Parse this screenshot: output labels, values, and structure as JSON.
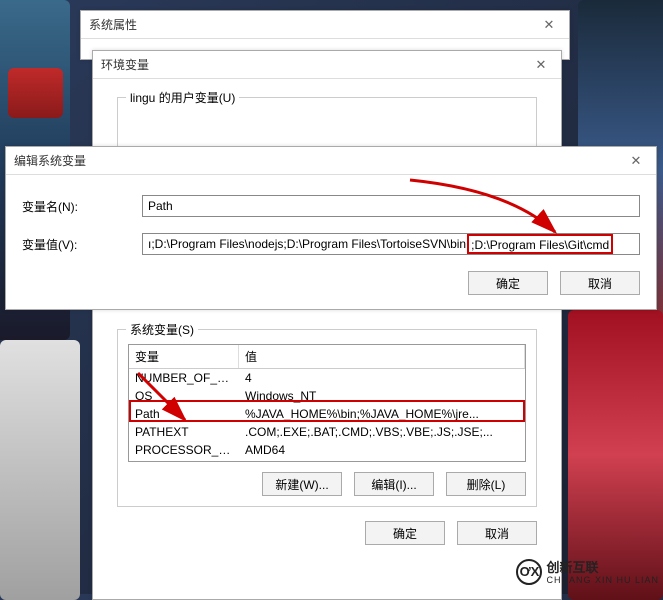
{
  "sysprops": {
    "title": "系统属性"
  },
  "envvars": {
    "title": "环境变量",
    "user_group_label": "lingu 的用户变量(U)",
    "col_name": "变量",
    "col_value": "值",
    "sys_group_label": "系统变量(S)",
    "sys_rows": [
      {
        "name": "NUMBER_OF_PR...",
        "value": "4"
      },
      {
        "name": "OS",
        "value": "Windows_NT"
      },
      {
        "name": "Path",
        "value": "%JAVA_HOME%\\bin;%JAVA_HOME%\\jre..."
      },
      {
        "name": "PATHEXT",
        "value": ".COM;.EXE;.BAT;.CMD;.VBS;.VBE;.JS;.JSE;..."
      },
      {
        "name": "PROCESSOR_AR...",
        "value": "AMD64"
      }
    ],
    "btn_new": "新建(W)...",
    "btn_edit": "编辑(I)...",
    "btn_delete": "删除(L)",
    "btn_ok": "确定",
    "btn_cancel": "取消"
  },
  "edit": {
    "title": "编辑系统变量",
    "name_label": "变量名(N):",
    "name_value": "Path",
    "value_label": "变量值(V):",
    "value_prefix": "ı;D:\\Program Files\\nodejs;D:\\Program Files\\TortoiseSVN\\bin",
    "value_highlight": ";D:\\Program Files\\Git\\cmd",
    "btn_ok": "确定",
    "btn_cancel": "取消"
  },
  "watermark": {
    "brand": "创新互联",
    "sub": "CHUANG XIN HU LIAN"
  }
}
